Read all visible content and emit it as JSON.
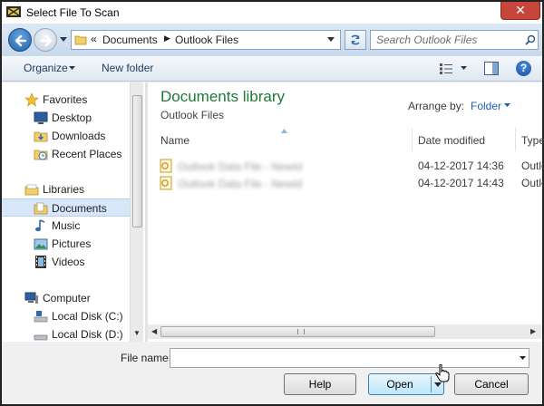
{
  "window": {
    "title": "Select File To Scan",
    "close_label": "✕"
  },
  "address": {
    "chevron": "«",
    "crumbs": [
      "Documents",
      "Outlook Files"
    ],
    "separator": "▶"
  },
  "search": {
    "placeholder": "Search Outlook Files"
  },
  "toolbar": {
    "organize_label": "Organize",
    "new_folder_label": "New folder",
    "help_label": "?"
  },
  "nav": {
    "favorites": {
      "label": "Favorites",
      "items": [
        "Desktop",
        "Downloads",
        "Recent Places"
      ]
    },
    "libraries": {
      "label": "Libraries",
      "items": [
        "Documents",
        "Music",
        "Pictures",
        "Videos"
      ],
      "selected": "Documents"
    },
    "computer": {
      "label": "Computer",
      "items": [
        "Local Disk (C:)",
        "Local Disk (D:)"
      ]
    }
  },
  "content": {
    "library_title": "Documents library",
    "library_subtitle": "Outlook Files",
    "arrange_label": "Arrange by:",
    "arrange_value": "Folder",
    "columns": [
      "Name",
      "Date modified",
      "Type"
    ],
    "files": [
      {
        "name": "Outlook Data File - NewId",
        "date": "04-12-2017 14:36",
        "type": "Outlo"
      },
      {
        "name": "Outlook Data File - NewId",
        "date": "04-12-2017 14:43",
        "type": "Outlo"
      }
    ]
  },
  "bottom": {
    "file_name_label": "File name:",
    "file_name_value": "",
    "help_button": "Help",
    "open_button": "Open",
    "cancel_button": "Cancel"
  },
  "icons": {
    "app": "chip-icon",
    "back": "back-arrow-icon",
    "forward": "forward-arrow-icon",
    "refresh": "refresh-icon",
    "search": "search-icon",
    "views": "views-icon",
    "preview": "preview-pane-icon",
    "help": "help-icon",
    "folder": "folder-icon",
    "pst_file": "outlook-file-icon"
  },
  "colors": {
    "library_title": "#1e7a37",
    "link": "#1f5fa8",
    "selection": "#d7e6f8",
    "close": "#c7463c"
  }
}
